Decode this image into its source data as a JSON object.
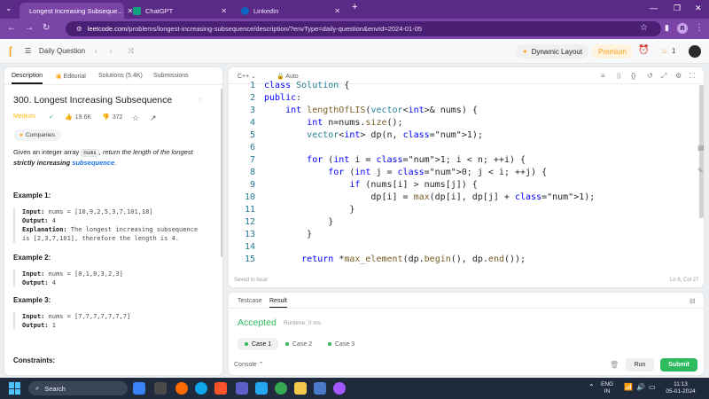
{
  "browser": {
    "tabs": [
      {
        "title": "Longest Increasing Subseque...",
        "fav_color": "#ffa116",
        "active": true
      },
      {
        "title": "ChatGPT",
        "fav_color": "#10a37f",
        "active": false
      },
      {
        "title": "LinkedIn",
        "fav_color": "#0a66c2",
        "active": false
      }
    ],
    "url_host": "leetcode.com",
    "url_path": "/problems/longest-increasing-subsequence/description/?envType=daily-question&envId=2024-01-05",
    "profile_letter": "R"
  },
  "lc_header": {
    "daily_question": "Daily Question",
    "dynamic_layout": "Dynamic Layout",
    "premium": "Premium",
    "streak": "1"
  },
  "left": {
    "tabs": [
      "Description",
      "Editorial",
      "Solutions (5.4K)",
      "Submissions"
    ],
    "title": "300. Longest Increasing Subsequence",
    "difficulty": "Medium",
    "likes": "19.6K",
    "dislikes": "372",
    "companies": "Companies",
    "desc_a": "Given an integer array ",
    "desc_code": "nums",
    "desc_b": ", return the length of the longest ",
    "desc_strictly": "strictly increasing",
    "desc_link": "subsequence",
    "desc_end": ".",
    "examples": [
      {
        "title": "Example 1:",
        "input_label": "Input:",
        "input": " nums = [10,9,2,5,3,7,101,18]",
        "output_label": "Output:",
        "output": " 4",
        "expl_label": "Explanation:",
        "expl_1": " The longest increasing subsequence",
        "expl_2": "is [2,3,7,101], therefore the length is 4."
      },
      {
        "title": "Example 2:",
        "input_label": "Input:",
        "input": " nums = [0,1,0,3,2,3]",
        "output_label": "Output:",
        "output": " 4"
      },
      {
        "title": "Example 3:",
        "input_label": "Input:",
        "input": " nums = [7,7,7,7,7,7,7]",
        "output_label": "Output:",
        "output": " 1"
      }
    ],
    "constraints": "Constraints:"
  },
  "editor": {
    "language": "C++",
    "mode": "Auto",
    "saved": "Saved to local",
    "cursor": "Ln 8, Col 27",
    "lines": [
      {
        "n": "1",
        "code": "class Solution {"
      },
      {
        "n": "2",
        "code": "public:"
      },
      {
        "n": "3",
        "code": "    int lengthOfLIS(vector<int>& nums) {"
      },
      {
        "n": "4",
        "code": "        int n=nums.size();"
      },
      {
        "n": "5",
        "code": "        vector<int> dp(n, 1);"
      },
      {
        "n": "6",
        "code": ""
      },
      {
        "n": "7",
        "code": "        for (int i = 1; i < n; ++i) {"
      },
      {
        "n": "8",
        "code": "            for (int j = 0; j < i; ++j) {"
      },
      {
        "n": "9",
        "code": "                if (nums[i] > nums[j]) {"
      },
      {
        "n": "10",
        "code": "                    dp[i] = max(dp[i], dp[j] + 1);"
      },
      {
        "n": "11",
        "code": "                }"
      },
      {
        "n": "12",
        "code": "            }"
      },
      {
        "n": "13",
        "code": "        }"
      },
      {
        "n": "14",
        "code": ""
      },
      {
        "n": "15",
        "code": "       return *max_element(dp.begin(), dp.end());"
      }
    ]
  },
  "result": {
    "tabs": [
      "Testcase",
      "Result"
    ],
    "status": "Accepted",
    "runtime": "Runtime: 0 ms",
    "cases": [
      "Case 1",
      "Case 2",
      "Case 3"
    ],
    "console": "Console",
    "run": "Run",
    "submit": "Submit"
  },
  "taskbar": {
    "search": "Search",
    "lang": "ENG",
    "region": "IN",
    "time": "11:13",
    "date": "05-01-2024"
  }
}
